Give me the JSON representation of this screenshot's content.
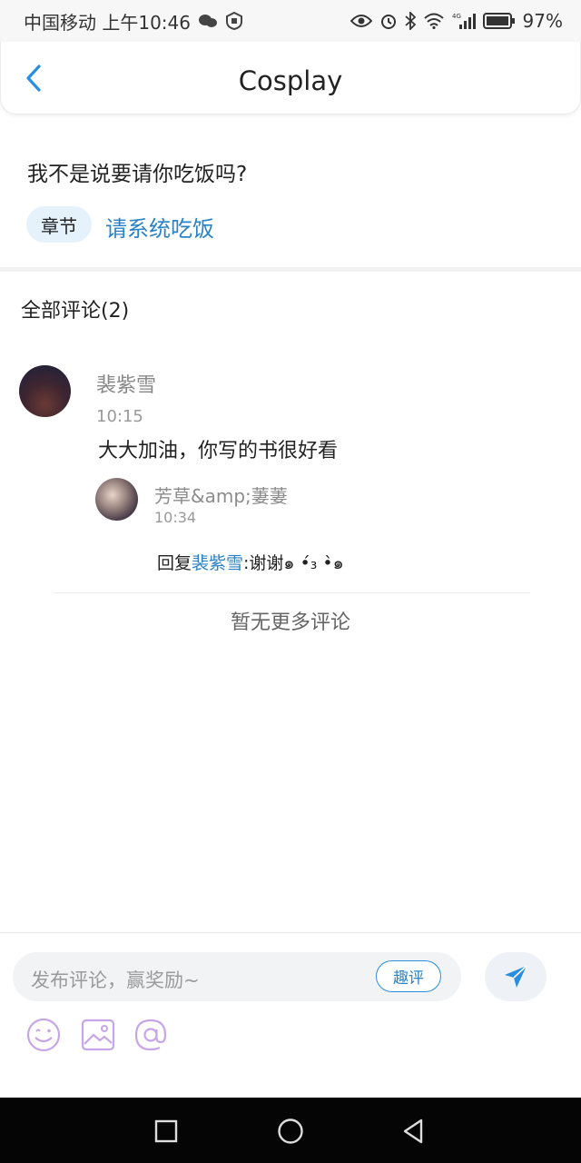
{
  "status_bar": {
    "carrier_time": "中国移动 上午10:46",
    "battery": "97%",
    "network": "4G"
  },
  "header": {
    "title": "Cosplay",
    "back_icon": "chevron-left-icon"
  },
  "chapter": {
    "question": "我不是说要请你吃饭吗?",
    "tag": "章节",
    "link": "请系统吃饭"
  },
  "comments_header": "全部评论(2)",
  "comments": [
    {
      "name": "裴紫雪",
      "time": "10:15",
      "text": "大大加油，你写的书很好看",
      "reply": {
        "name": "芳草&amp;萋萋",
        "time": "10:34",
        "prefix": "回复",
        "target": "裴紫雪",
        "text": ":谢谢๑ •́₃ •̀๑"
      }
    }
  ],
  "no_more": "暂无更多评论",
  "composer": {
    "placeholder": "发布评论，赢奖励~",
    "fun_button": "趣评",
    "tools": [
      "emoji-icon",
      "image-icon",
      "at-icon"
    ]
  },
  "colors": {
    "accent": "#2a82c6",
    "tool_purple": "#c7a6e8",
    "send": "#2a8ee0"
  }
}
